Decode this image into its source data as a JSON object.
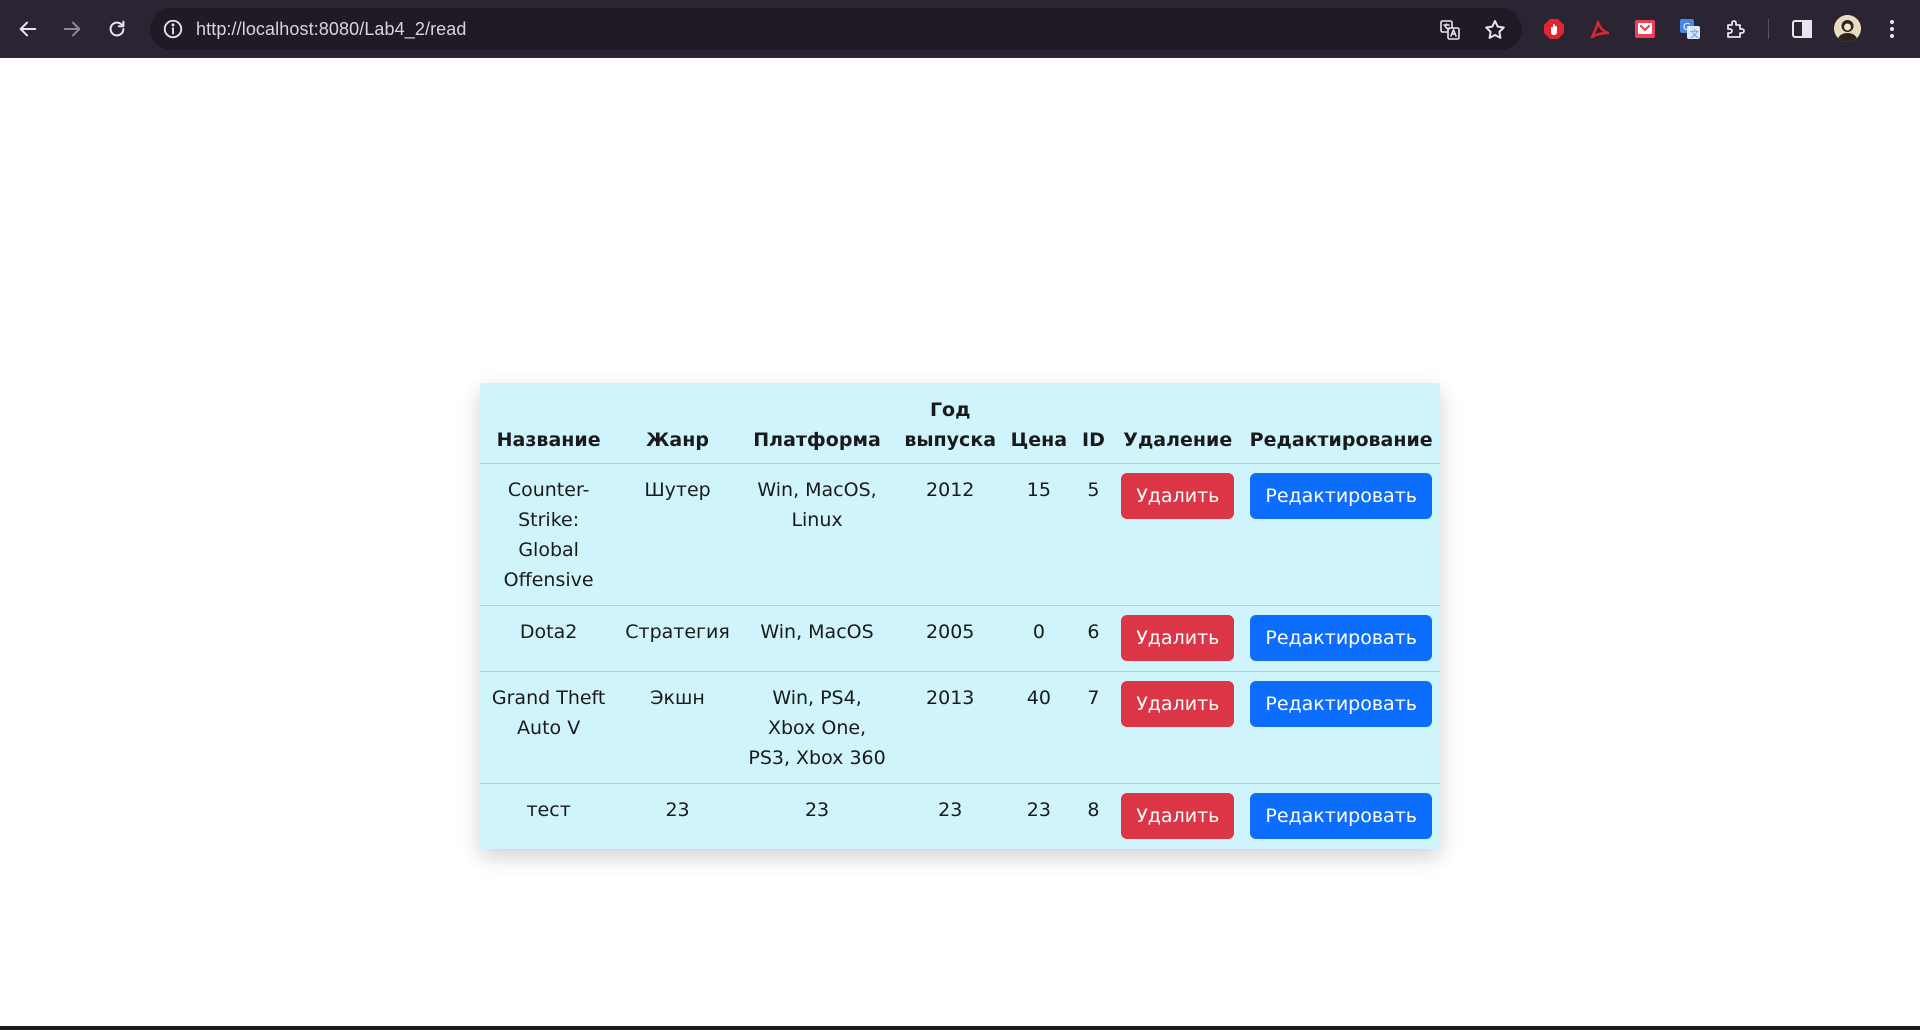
{
  "browser": {
    "url": "http://localhost:8080/Lab4_2/read"
  },
  "table": {
    "headers": [
      "Название",
      "Жанр",
      "Платформа",
      "Год выпуска",
      "Цена",
      "ID",
      "Удаление",
      "Редактирование"
    ],
    "rows": [
      {
        "name": "Counter-Strike: Global Offensive",
        "genre": "Шутер",
        "platform": "Win, MacOS, Linux",
        "year": "2012",
        "price": "15",
        "id": "5"
      },
      {
        "name": "Dota2",
        "genre": "Стратегия",
        "platform": "Win, MacOS",
        "year": "2005",
        "price": "0",
        "id": "6"
      },
      {
        "name": "Grand Theft Auto V",
        "genre": "Экшн",
        "platform": "Win, PS4, Xbox One, PS3, Xbox 360",
        "year": "2013",
        "price": "40",
        "id": "7"
      },
      {
        "name": "тест",
        "genre": "23",
        "platform": "23",
        "year": "23",
        "price": "23",
        "id": "8"
      }
    ],
    "delete_label": "Удалить",
    "edit_label": "Редактировать"
  },
  "colors": {
    "table_bg": "#cff4fc",
    "delete_btn": "#dc3545",
    "edit_btn": "#0d6efd",
    "chrome_bg": "#2b2433"
  }
}
